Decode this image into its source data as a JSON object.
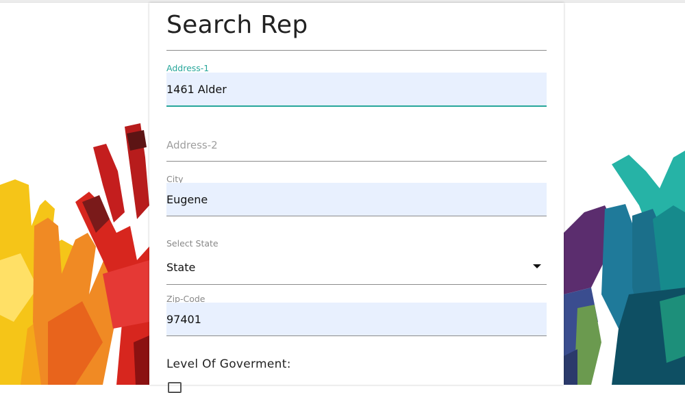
{
  "form": {
    "title": "Search Rep",
    "address1": {
      "label": "Address-1",
      "value": "1461 Alder"
    },
    "address2": {
      "placeholder": "Address-2",
      "value": ""
    },
    "city": {
      "label": "City",
      "value": "Eugene"
    },
    "state": {
      "label": "Select State",
      "value": "State"
    },
    "zip": {
      "label": "Zip-Code",
      "value": "97401"
    },
    "level_heading": "Level Of Goverment:"
  },
  "colors": {
    "accent": "#26a69a",
    "autofill_bg": "#e8f0fe"
  },
  "icons": {
    "state_dropdown": "caret-down-icon",
    "background": "colorful-raised-hands-illustration"
  }
}
